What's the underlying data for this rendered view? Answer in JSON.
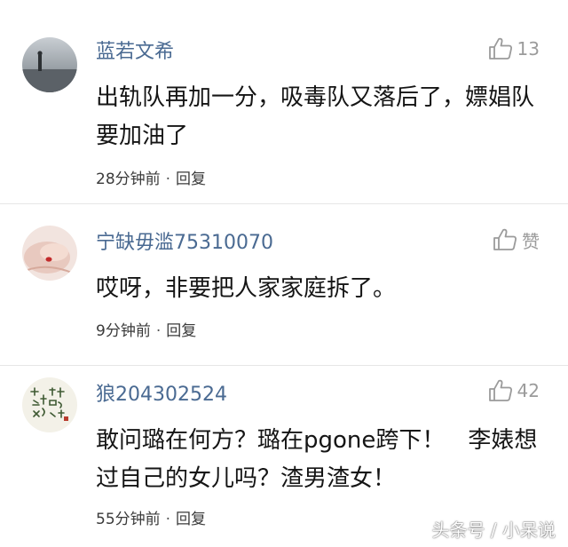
{
  "comments": [
    {
      "username": "蓝若文希",
      "like_text": "13",
      "text": "出轨队再加一分，吸毒队又落后了，嫖娼队要加油了",
      "time": "28分钟前",
      "separator": "·",
      "reply_label": "回复"
    },
    {
      "username": "宁缺毋滥75310070",
      "like_text": "赞",
      "text": "哎呀，非要把人家家庭拆了。",
      "time": "9分钟前",
      "separator": "·",
      "reply_label": "回复"
    },
    {
      "username": "狼204302524",
      "like_text": "42",
      "text": "敢问璐在何方？璐在pgone跨下！　李婊想过自己的女儿吗？渣男渣女！",
      "time": "55分钟前",
      "separator": "·",
      "reply_label": "回复"
    }
  ],
  "watermark": "头条号 / 小呆说",
  "colors": {
    "username": "#4a6a92",
    "body_text": "#151515",
    "meta_text": "#3a3a3a",
    "like_icon": "#9b9b9b",
    "divider": "#e6e6e6"
  },
  "icons": {
    "like": "thumbs-up-icon"
  }
}
